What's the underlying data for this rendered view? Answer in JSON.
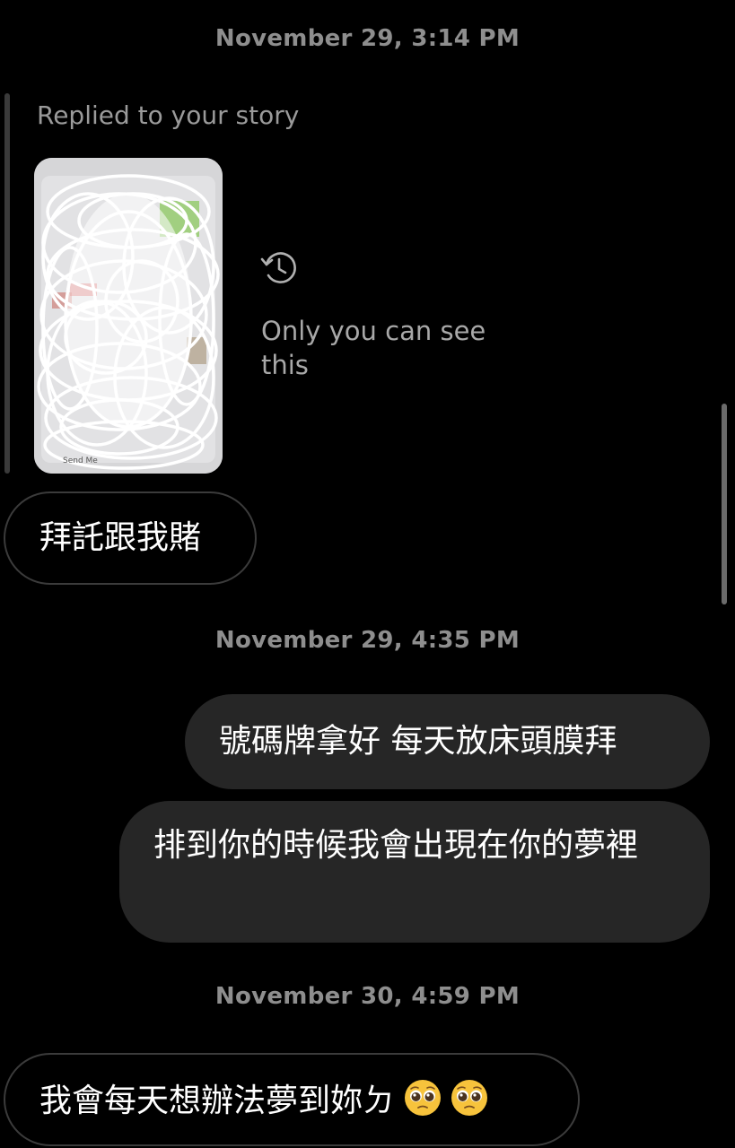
{
  "thread": {
    "timestamp_1": "November 29, 3:14 PM",
    "story_reply": {
      "label": "Replied to your story",
      "story_icon": "history-icon",
      "notice": "Only you can see this",
      "thumb_caption": "Send Me"
    },
    "message_1": "拜託跟我賭",
    "timestamp_2": "November 29, 4:35 PM",
    "message_2": "號碼牌拿好 每天放床頭膜拜",
    "message_3": "排到你的時候我會出現在你的夢裡",
    "timestamp_3": "November 30, 4:59 PM",
    "message_4": {
      "text": "我會每天想辦法夢到妳ㄉ",
      "emoji": [
        "🥺",
        "🥺"
      ]
    }
  },
  "colors": {
    "background": "#000000",
    "timestamp_text": "#8e8e8e",
    "incoming_border": "#3b3b3b",
    "outgoing_bubble": "#262626",
    "secondary_text": "#a8a8a8"
  }
}
